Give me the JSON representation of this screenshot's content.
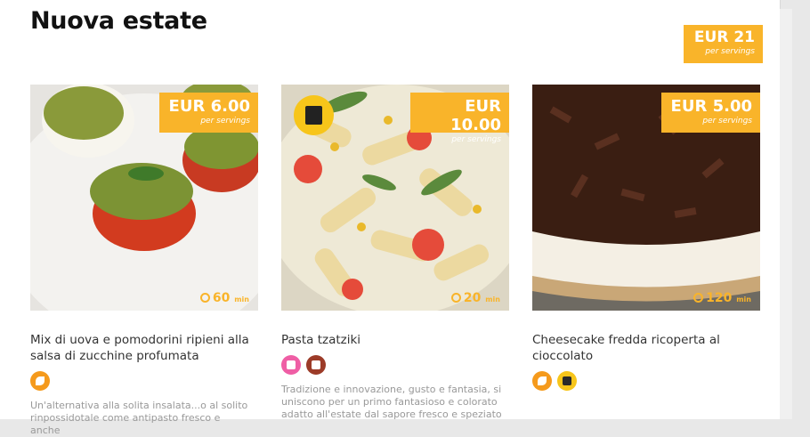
{
  "page": {
    "title": "Nuova estate"
  },
  "total": {
    "amount": "EUR 21",
    "per": "per servings"
  },
  "cards": [
    {
      "price": "EUR  6.00",
      "per": "per servings",
      "time": "60",
      "unit": "min",
      "name": "Mix di uova e pomodorini ripieni alla salsa di zucchine profumata",
      "badges": [
        "vegetarian-icon"
      ],
      "desc": "Un'alternativa alla solita insalata...o al solito rinpossidotale come antipasto fresco e anche"
    },
    {
      "price": "EUR  10.00",
      "per": "per servings",
      "time": "20",
      "unit": "min",
      "name": "Pasta tzatziki",
      "badges": [
        "pink-tag-icon",
        "brown-tag-icon"
      ],
      "desc": "Tradizione e innovazione, gusto e fantasia, si uniscono per un primo fantasioso e colorato adatto all'estate dal sapore fresco e speziato"
    },
    {
      "price": "EUR  5.00",
      "per": "per servings",
      "time": "120",
      "unit": "min",
      "name": "Cheesecake fredda ricoperta al cioccolato",
      "badges": [
        "vegetarian-icon",
        "bag-icon"
      ],
      "desc": ""
    }
  ]
}
